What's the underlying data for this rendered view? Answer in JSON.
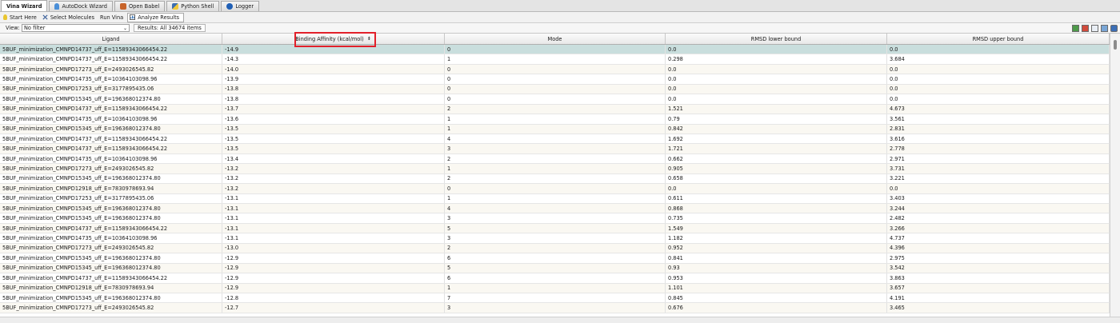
{
  "tabs": [
    {
      "label": "Vina Wizard",
      "icon": "none",
      "active": true
    },
    {
      "label": "AutoDock Wizard",
      "icon": "bulb-icon",
      "active": false
    },
    {
      "label": "Open Babel",
      "icon": "babel-icon",
      "active": false
    },
    {
      "label": "Python Shell",
      "icon": "python-icon",
      "active": false
    },
    {
      "label": "Logger",
      "icon": "info-icon",
      "active": false
    }
  ],
  "wizard_steps": [
    {
      "label": "Start Here",
      "icon": "bulb-icon",
      "active": false
    },
    {
      "label": "Select Molecules",
      "icon": "cross-arrows-icon",
      "active": false
    },
    {
      "label": "Run Vina",
      "icon": "none",
      "active": false
    },
    {
      "label": "Analyze Results",
      "icon": "chart-icon",
      "active": true
    }
  ],
  "view": {
    "label": "View:",
    "value": "No filter"
  },
  "results": {
    "text": "Results: All 34674 items"
  },
  "columns": [
    "Ligand",
    "Binding Affinity (kcal/mol)",
    "Mode",
    "RMSD lower bound",
    "RMSD upper bound"
  ],
  "rows": [
    [
      "5BUF_minimization_CMNPD14737_uff_E=11589343066454.22",
      "-14.9",
      "0",
      "0.0",
      "0.0"
    ],
    [
      "5BUF_minimization_CMNPD14737_uff_E=11589343066454.22",
      "-14.3",
      "1",
      "0.298",
      "3.684"
    ],
    [
      "5BUF_minimization_CMNPD17273_uff_E=2493026545.82",
      "-14.0",
      "0",
      "0.0",
      "0.0"
    ],
    [
      "5BUF_minimization_CMNPD14735_uff_E=10364103098.96",
      "-13.9",
      "0",
      "0.0",
      "0.0"
    ],
    [
      "5BUF_minimization_CMNPD17253_uff_E=3177895435.06",
      "-13.8",
      "0",
      "0.0",
      "0.0"
    ],
    [
      "5BUF_minimization_CMNPD15345_uff_E=196368012374.80",
      "-13.8",
      "0",
      "0.0",
      "0.0"
    ],
    [
      "5BUF_minimization_CMNPD14737_uff_E=11589343066454.22",
      "-13.7",
      "2",
      "1.521",
      "4.673"
    ],
    [
      "5BUF_minimization_CMNPD14735_uff_E=10364103098.96",
      "-13.6",
      "1",
      "0.79",
      "3.561"
    ],
    [
      "5BUF_minimization_CMNPD15345_uff_E=196368012374.80",
      "-13.5",
      "1",
      "0.842",
      "2.831"
    ],
    [
      "5BUF_minimization_CMNPD14737_uff_E=11589343066454.22",
      "-13.5",
      "4",
      "1.692",
      "3.616"
    ],
    [
      "5BUF_minimization_CMNPD14737_uff_E=11589343066454.22",
      "-13.5",
      "3",
      "1.721",
      "2.778"
    ],
    [
      "5BUF_minimization_CMNPD14735_uff_E=10364103098.96",
      "-13.4",
      "2",
      "0.662",
      "2.971"
    ],
    [
      "5BUF_minimization_CMNPD17273_uff_E=2493026545.82",
      "-13.2",
      "1",
      "0.905",
      "3.731"
    ],
    [
      "5BUF_minimization_CMNPD15345_uff_E=196368012374.80",
      "-13.2",
      "2",
      "0.658",
      "3.221"
    ],
    [
      "5BUF_minimization_CMNPD12918_uff_E=7830978693.94",
      "-13.2",
      "0",
      "0.0",
      "0.0"
    ],
    [
      "5BUF_minimization_CMNPD17253_uff_E=3177895435.06",
      "-13.1",
      "1",
      "0.611",
      "3.403"
    ],
    [
      "5BUF_minimization_CMNPD15345_uff_E=196368012374.80",
      "-13.1",
      "4",
      "0.868",
      "3.244"
    ],
    [
      "5BUF_minimization_CMNPD15345_uff_E=196368012374.80",
      "-13.1",
      "3",
      "0.735",
      "2.482"
    ],
    [
      "5BUF_minimization_CMNPD14737_uff_E=11589343066454.22",
      "-13.1",
      "5",
      "1.549",
      "3.266"
    ],
    [
      "5BUF_minimization_CMNPD14735_uff_E=10364103098.96",
      "-13.1",
      "3",
      "1.182",
      "4.737"
    ],
    [
      "5BUF_minimization_CMNPD17273_uff_E=2493026545.82",
      "-13.0",
      "2",
      "0.952",
      "4.396"
    ],
    [
      "5BUF_minimization_CMNPD15345_uff_E=196368012374.80",
      "-12.9",
      "6",
      "0.841",
      "2.975"
    ],
    [
      "5BUF_minimization_CMNPD15345_uff_E=196368012374.80",
      "-12.9",
      "5",
      "0.93",
      "3.542"
    ],
    [
      "5BUF_minimization_CMNPD14737_uff_E=11589343066454.22",
      "-12.9",
      "6",
      "0.953",
      "3.863"
    ],
    [
      "5BUF_minimization_CMNPD12918_uff_E=7830978693.94",
      "-12.9",
      "1",
      "1.101",
      "3.657"
    ],
    [
      "5BUF_minimization_CMNPD15345_uff_E=196368012374.80",
      "-12.8",
      "7",
      "0.845",
      "4.191"
    ],
    [
      "5BUF_minimization_CMNPD17273_uff_E=2493026545.82",
      "-12.7",
      "3",
      "0.676",
      "3.465"
    ]
  ],
  "selected_row": 0,
  "sort": {
    "column": "Binding Affinity (kcal/mol)",
    "direction": "ascending"
  },
  "colors": {
    "selected_row": "#c9dedd",
    "highlight_box": "#e2202a"
  }
}
